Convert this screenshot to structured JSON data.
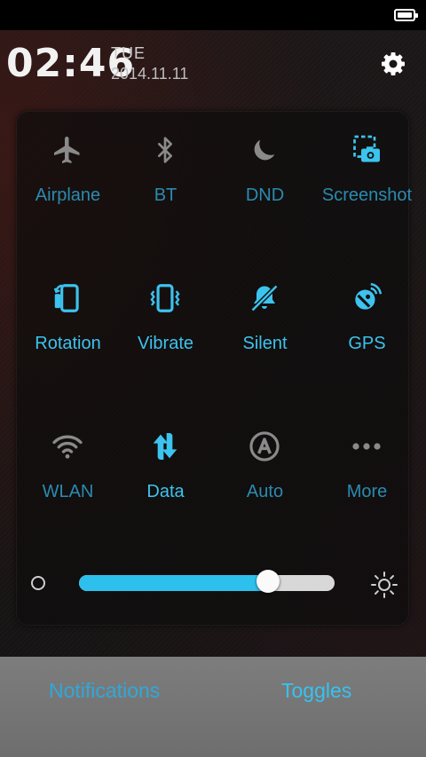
{
  "clock": {
    "time": "02:46",
    "day": "TUE",
    "date": "2014.11.11"
  },
  "toggles": [
    {
      "label": "Airplane",
      "icon": "airplane-icon",
      "state": "off"
    },
    {
      "label": "BT",
      "icon": "bluetooth-icon",
      "state": "off"
    },
    {
      "label": "DND",
      "icon": "moon-icon",
      "state": "off"
    },
    {
      "label": "Screenshot",
      "icon": "screenshot-icon",
      "state": "active"
    },
    {
      "label": "Rotation",
      "icon": "rotation-icon",
      "state": "on"
    },
    {
      "label": "Vibrate",
      "icon": "vibrate-icon",
      "state": "on"
    },
    {
      "label": "Silent",
      "icon": "silent-bell-icon",
      "state": "on"
    },
    {
      "label": "GPS",
      "icon": "gps-icon",
      "state": "on"
    },
    {
      "label": "WLAN",
      "icon": "wifi-icon",
      "state": "off"
    },
    {
      "label": "Data",
      "icon": "data-sync-icon",
      "state": "on"
    },
    {
      "label": "Auto",
      "icon": "auto-brightness-icon",
      "state": "off"
    },
    {
      "label": "More",
      "icon": "more-icon",
      "state": "off"
    }
  ],
  "brightness": {
    "level": 0.74
  },
  "tabs": {
    "notifications": "Notifications",
    "toggles": "Toggles"
  },
  "colors": {
    "accent": "#3cc3ee",
    "off_icon": "#8a8a8a",
    "tab_bar": "#777777"
  }
}
